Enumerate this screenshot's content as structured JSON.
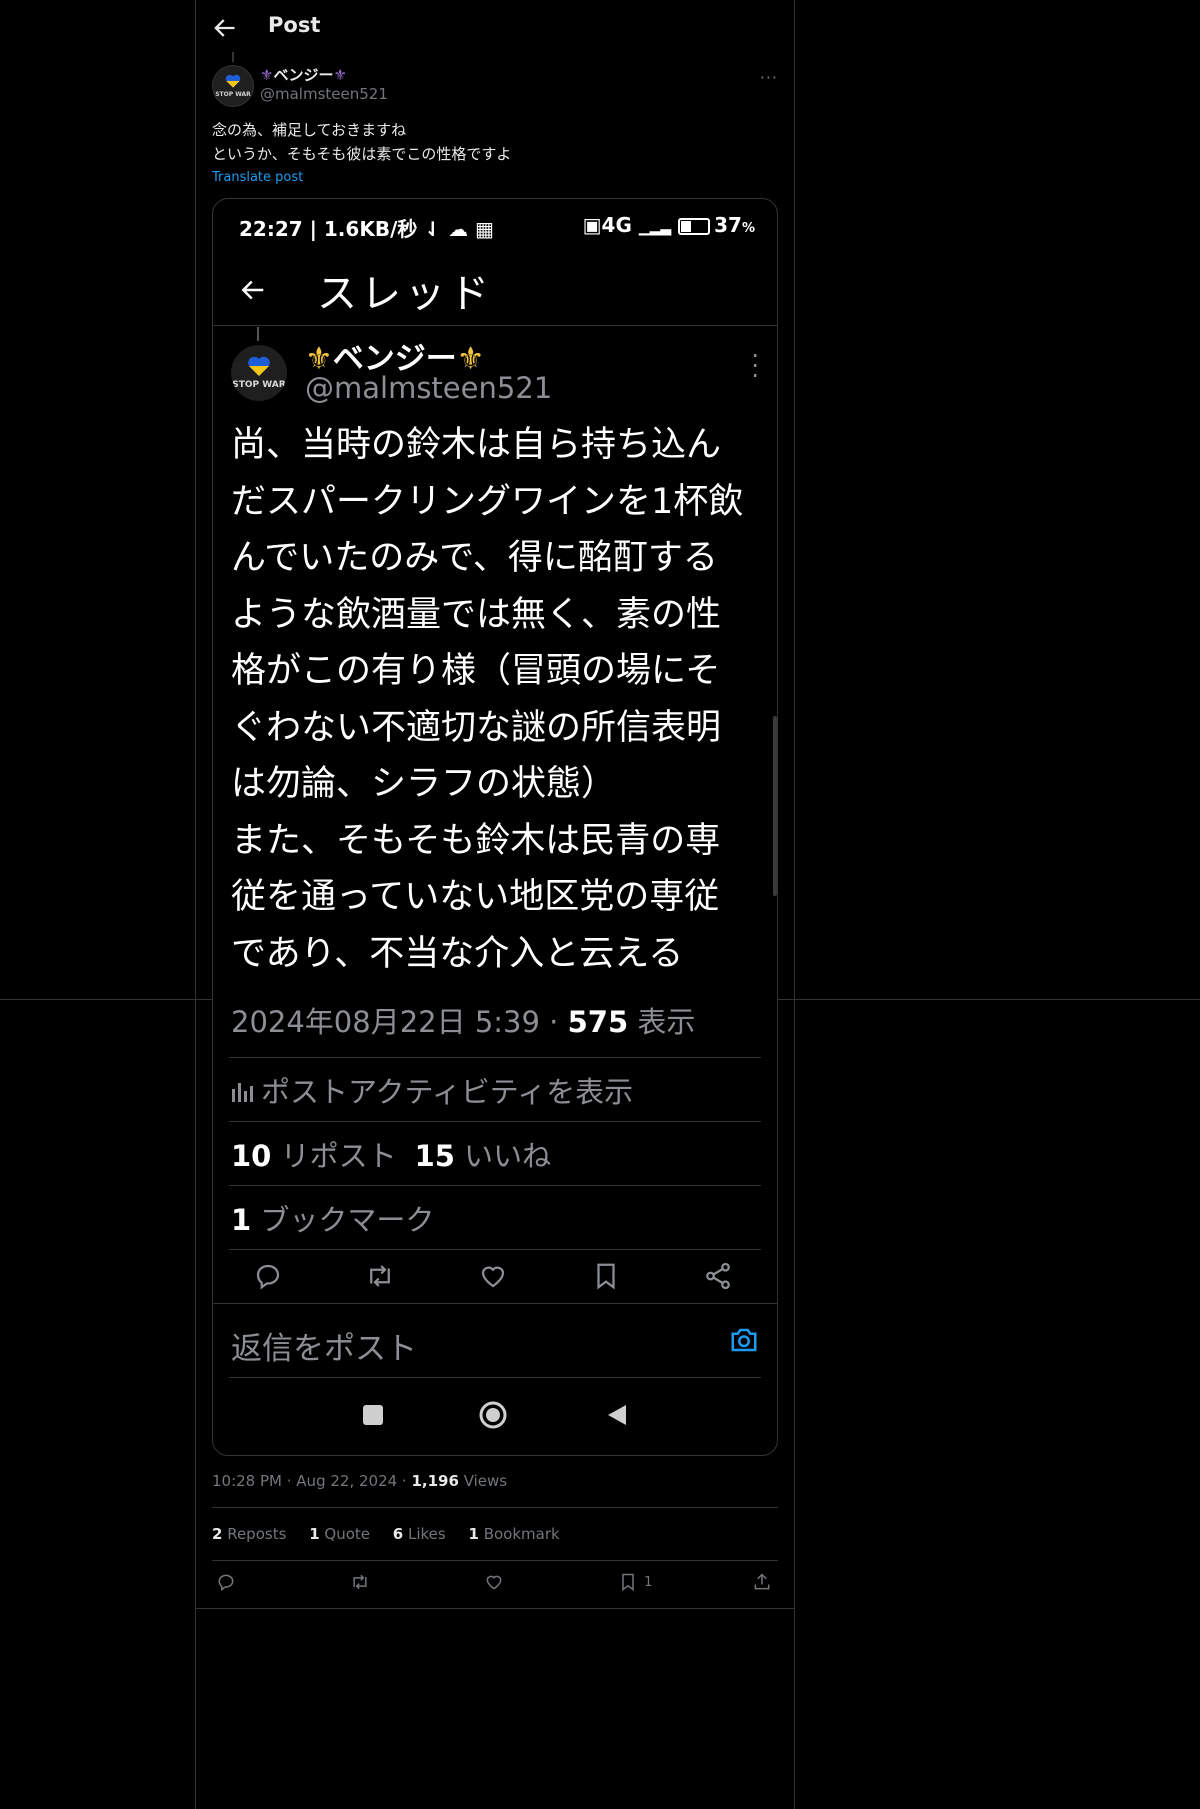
{
  "header": {
    "title": "Post",
    "back_icon": "arrow-left-icon"
  },
  "author": {
    "name": "ベンジー",
    "handle": "@malmsteen521",
    "avatar_badge": "STOP WAR"
  },
  "post": {
    "lines": [
      "念の為、補足しておきますね",
      "というか、そもそも彼は素でこの性格ですよ"
    ],
    "translate_label": "Translate post"
  },
  "embedded": {
    "status_left": "22:27 | 1.6KB/秒",
    "status_right": "4G",
    "battery": "37",
    "battery_unit": "%",
    "battery_level": 0.37,
    "screen_title": "スレッド",
    "author_name": "ベンジー",
    "author_handle": "@malmsteen521",
    "avatar_badge": "STOP WAR",
    "body_lines": [
      "尚、当時の鈴木は自ら持ち込ん",
      "だスパークリングワインを1杯飲",
      "んでいたのみで、得に酩酊する",
      "ような飲酒量では無く、素の性",
      "格がこの有り様（冒頭の場にそ",
      "ぐわない不適切な謎の所信表明",
      "は勿論、シラフの状態）",
      "また、そもそも鈴木は民青の専",
      "従を通っていない地区党の専従",
      "であり、不当な介入と云える"
    ],
    "timestamp": "2024年08月22日 5:39 · ",
    "views_count": "575",
    "views_label": " 表示",
    "activity_label": "ポストアクティビティを表示",
    "reposts_count": "10",
    "reposts_label": " リポスト",
    "likes_count": "15",
    "likes_label": " いいね",
    "bookmarks_count": "1",
    "bookmarks_label": " ブックマーク",
    "reply_placeholder": "返信をポスト"
  },
  "meta": {
    "time": "10:28 PM",
    "sep": " · ",
    "date": "Aug 22, 2024",
    "views_count": "1,196",
    "views_label": " Views"
  },
  "stats": [
    {
      "count": "2",
      "label": " Reposts"
    },
    {
      "count": "1",
      "label": " Quote"
    },
    {
      "count": "6",
      "label": " Likes"
    },
    {
      "count": "1",
      "label": " Bookmark"
    }
  ],
  "actions": {
    "bookmark_count": "1"
  },
  "colors": {
    "accent": "#1d9bf0",
    "background": "#000000",
    "fleur_purple": "#9b6fd6",
    "fleur_gold": "#f2c53d",
    "muted": "#71767b"
  }
}
